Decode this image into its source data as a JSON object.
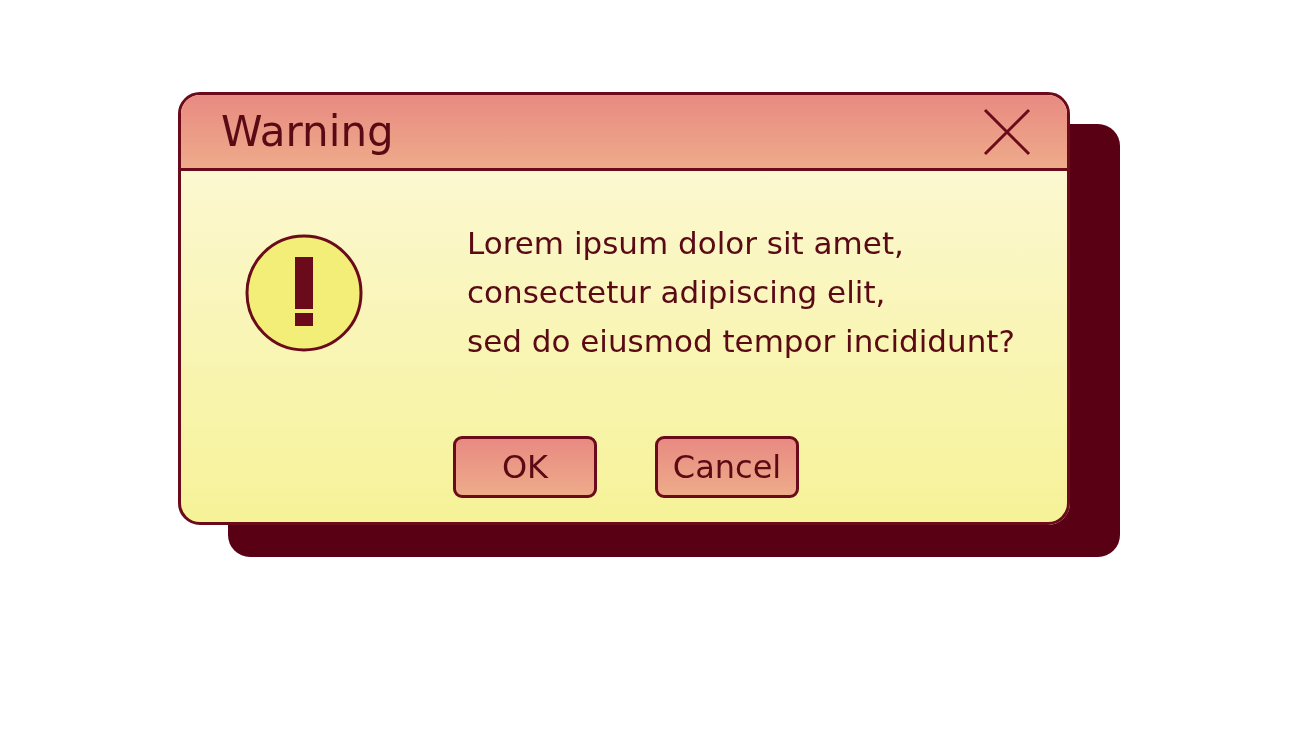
{
  "dialog": {
    "title": "Warning",
    "message_lines": [
      "Lorem ipsum dolor sit amet,",
      "consectetur adipiscing elit,",
      "sed do eiusmod tempor incididunt?"
    ],
    "buttons": [
      {
        "label": "OK"
      },
      {
        "label": "Cancel"
      }
    ]
  }
}
